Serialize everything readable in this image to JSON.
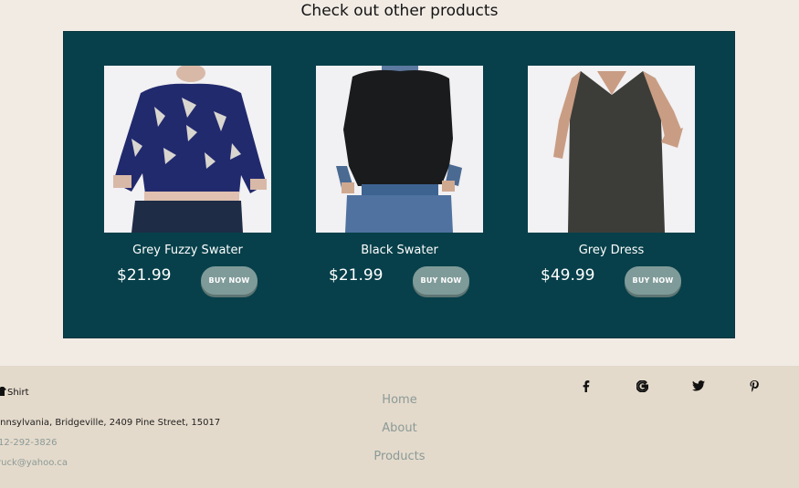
{
  "section": {
    "title": "Check out other products"
  },
  "products": [
    {
      "name": "Grey Fuzzy Swater",
      "price": "$21.99",
      "button": "BUY NOW"
    },
    {
      "name": "Black Swater",
      "price": "$21.99",
      "button": "BUY NOW"
    },
    {
      "name": "Grey Dress",
      "price": "$49.99",
      "button": "BUY NOW"
    }
  ],
  "footer": {
    "brand": "Shirt",
    "address": "ennsylvania, Bridgeville, 2409 Pine Street, 15017",
    "phone": "12-292-3826",
    "email": "ruck@yahoo.ca",
    "nav": [
      "Home",
      "About",
      "Products"
    ],
    "social": [
      "facebook-icon",
      "google-icon",
      "twitter-icon",
      "pinterest-icon"
    ]
  },
  "colors": {
    "panel": "#07404a",
    "button": "#7f9b99",
    "page": "#f1ebe4",
    "footer": "#e4dacb",
    "muted": "#8b9a98"
  }
}
